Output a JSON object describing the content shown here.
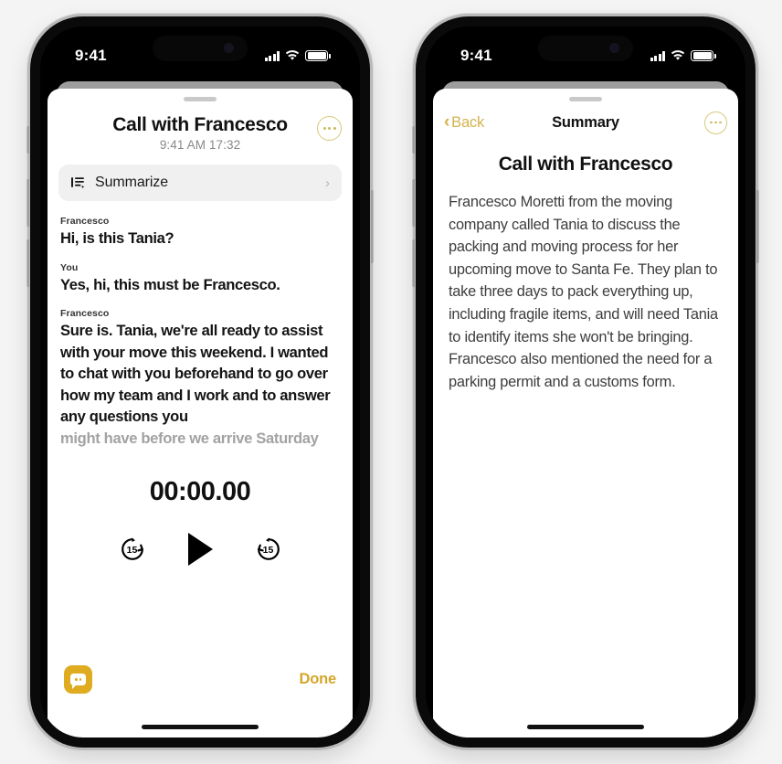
{
  "background_color": "#f4f4f4",
  "accent_gold": "#d4a72c",
  "left_phone": {
    "status_bar": {
      "time": "9:41",
      "cellular_icon": "signal-bars-icon",
      "wifi_icon": "wifi-icon",
      "battery_icon": "battery-icon"
    },
    "sheet": {
      "grabber": "sheet-grabber",
      "header": {
        "title": "Call with Francesco",
        "subtitle": "9:41 AM  17:32",
        "more_icon": "ellipsis-icon"
      },
      "summarize_row": {
        "icon": "text-lines-sparkle-icon",
        "label": "Summarize",
        "chevron": "›"
      },
      "transcript": [
        {
          "speaker": "Francesco",
          "text": "Hi, is this Tania?",
          "faded": false
        },
        {
          "speaker": "You",
          "text": "Yes, hi, this must be Francesco.",
          "faded": false
        },
        {
          "speaker": "Francesco",
          "text": "Sure is. Tania, we're all ready to assist with your move this weekend. I wanted to chat with you beforehand to go over how my team and I work and to answer any questions you",
          "faded": false
        },
        {
          "speaker": "",
          "text": "might have before we arrive Saturday",
          "faded": true
        }
      ],
      "player": {
        "elapsed": "00:00.00",
        "skip_back_label": "15",
        "skip_back_icon": "skip-back-15-icon",
        "play_icon": "play-icon",
        "skip_forward_label": "15",
        "skip_forward_icon": "skip-forward-15-icon"
      },
      "footer": {
        "transcript_icon": "speech-bubble-icon",
        "done_label": "Done"
      }
    }
  },
  "right_phone": {
    "status_bar": {
      "time": "9:41",
      "cellular_icon": "signal-bars-icon",
      "wifi_icon": "wifi-icon",
      "battery_icon": "battery-icon"
    },
    "sheet": {
      "grabber": "sheet-grabber",
      "navbar": {
        "back_chevron": "‹",
        "back_label": "Back",
        "title": "Summary",
        "more_icon": "ellipsis-icon"
      },
      "summary_title": "Call with Francesco",
      "summary_body": "Francesco Moretti from the moving company called Tania to discuss the packing and moving process for her upcoming move to Santa Fe. They plan to take three days to pack everything up, including fragile items, and will need Tania to identify items she won't be bringing. Francesco also mentioned the need for a parking permit and a customs form."
    }
  }
}
